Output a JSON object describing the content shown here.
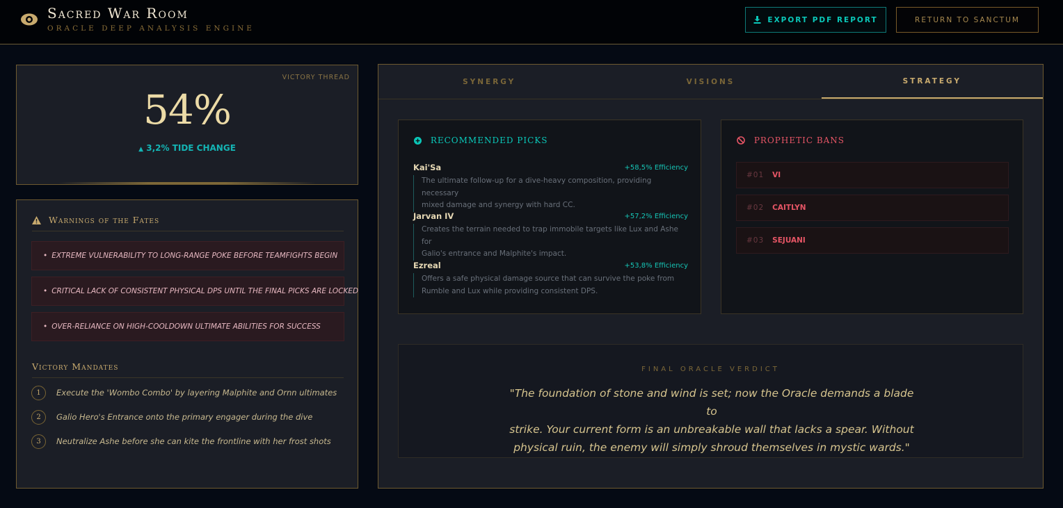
{
  "header": {
    "title": "Sacred War Room",
    "subtitle": "ORACLE DEEP ANALYSIS ENGINE",
    "export_label": "EXPORT PDF REPORT",
    "return_label": "RETURN TO SANCTUM"
  },
  "victory": {
    "label": "VICTORY THREAD",
    "value": "54%",
    "change": "3,2% TIDE CHANGE"
  },
  "warnings": {
    "title": "Warnings of the Fates",
    "items": [
      "EXTREME VULNERABILITY TO LONG-RANGE POKE BEFORE TEAMFIGHTS BEGIN",
      "CRITICAL LACK OF CONSISTENT PHYSICAL DPS UNTIL THE FINAL PICKS ARE LOCKED",
      "OVER-RELIANCE ON HIGH-COOLDOWN ULTIMATE ABILITIES FOR SUCCESS"
    ]
  },
  "mandates": {
    "title": "Victory Mandates",
    "items": [
      {
        "num": "1",
        "text": "Execute the 'Wombo Combo' by layering Malphite and Ornn ultimates"
      },
      {
        "num": "2",
        "text": "Galio Hero's Entrance onto the primary engager during the dive"
      },
      {
        "num": "3",
        "text": "Neutralize Ashe before she can kite the frontline with her frost shots"
      }
    ]
  },
  "tabs": [
    "SYNERGY",
    "VISIONS",
    "STRATEGY"
  ],
  "active_tab": "STRATEGY",
  "picks": {
    "title": "RECOMMENDED PICKS",
    "items": [
      {
        "name": "Kai'Sa",
        "efficiency": "+58,5% Efficiency",
        "desc_1": "The ultimate follow-up for a dive-heavy composition, providing necessary",
        "desc_2": "mixed damage and synergy with hard CC."
      },
      {
        "name": "Jarvan IV",
        "efficiency": "+57,2% Efficiency",
        "desc_1": "Creates the terrain needed to trap immobile targets like Lux and Ashe for",
        "desc_2": "Galio's entrance and Malphite's impact."
      },
      {
        "name": "Ezreal",
        "efficiency": "+53,8% Efficiency",
        "desc_1": "Offers a safe physical damage source that can survive the poke from",
        "desc_2": "Rumble and Lux while providing consistent DPS."
      }
    ]
  },
  "bans": {
    "title": "PROPHETIC BANS",
    "items": [
      {
        "num": "#01",
        "name": "VI"
      },
      {
        "num": "#02",
        "name": "CAITLYN"
      },
      {
        "num": "#03",
        "name": "SEJUANI"
      }
    ]
  },
  "verdict": {
    "label": "FINAL ORACLE VERDICT",
    "line_1": "\"The foundation of stone and wind is set; now the Oracle demands a blade to",
    "line_2": "strike. Your current form is an unbreakable wall that lacks a spear. Without",
    "line_3": "physical ruin, the enemy will simply shroud themselves in mystic wards.\""
  },
  "colors": {
    "gold": "#c8aa6e",
    "teal": "#0ac8b9",
    "danger": "#e55565",
    "background": "#050a14"
  }
}
